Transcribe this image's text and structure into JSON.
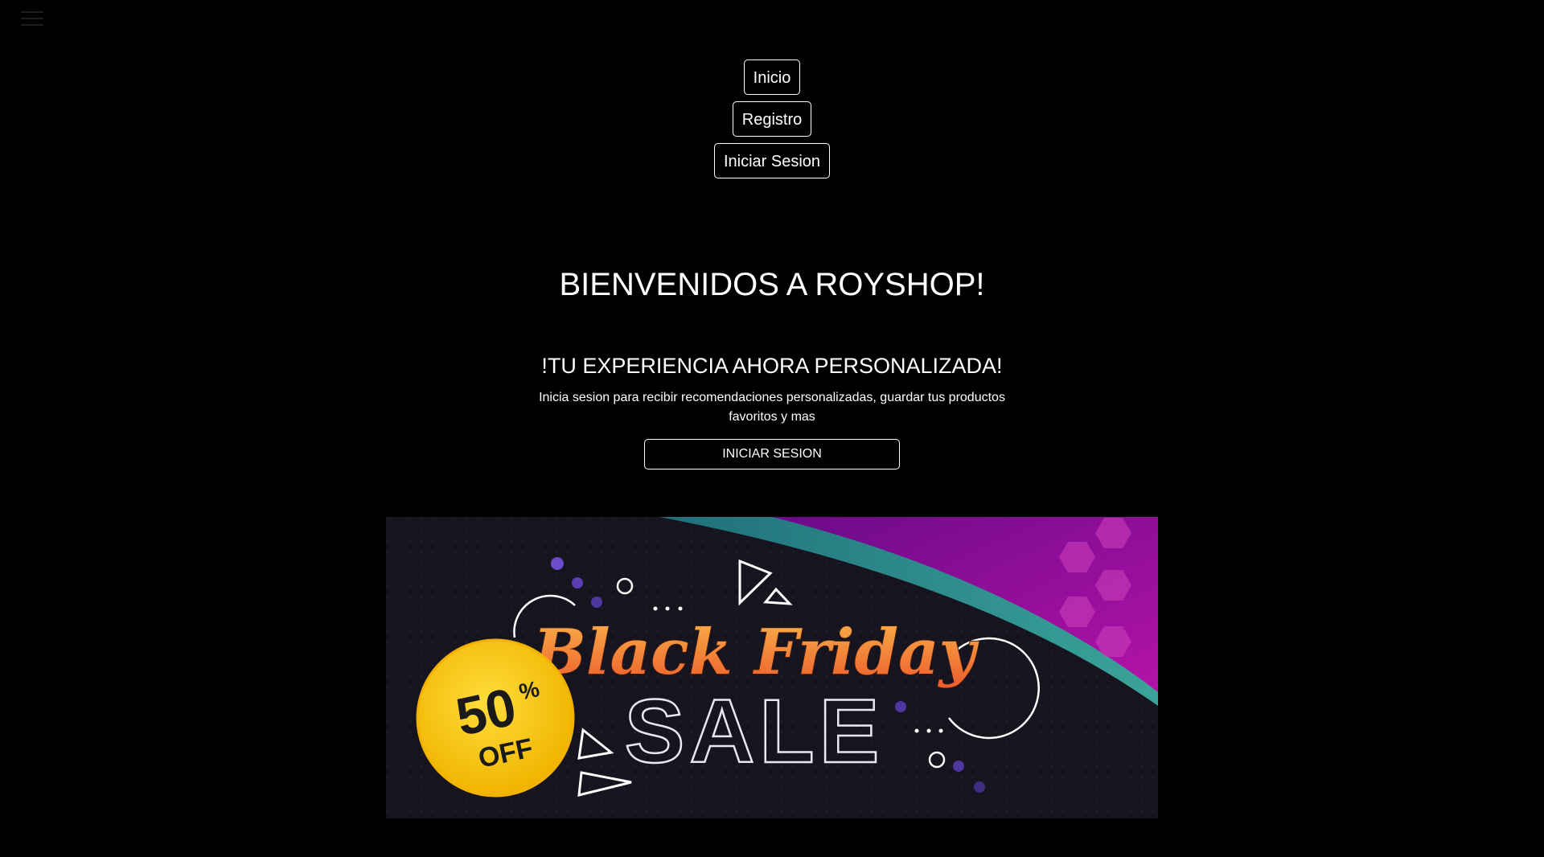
{
  "nav": {
    "menu_icon": "hamburger-menu-icon",
    "links": [
      "Inicio",
      "Registro",
      "Iniciar Sesion"
    ]
  },
  "hero": {
    "title": "BIENVENIDOS A ROYSHOP!"
  },
  "promo": {
    "heading": "!TU EXPERIENCIA AHORA PERSONALIZADA!",
    "text": "Inicia sesion para recibir recomendaciones personalizadas, guardar tus productos favoritos y mas",
    "button": "INICIAR SESION"
  },
  "banner": {
    "line1": "Black Friday",
    "line2": "SALE",
    "badge_percent": "50",
    "badge_percent_sign": "%",
    "badge_off": "OFF",
    "colors": {
      "background": "#16141f",
      "magenta": "#9a0fa6",
      "teal": "#2b8f8a",
      "badge_yellow": "#f6c41a",
      "text_orange": "#f58a25"
    }
  }
}
